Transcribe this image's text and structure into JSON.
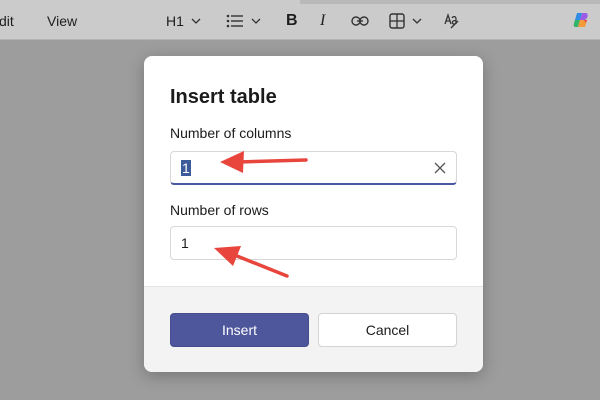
{
  "menu": {
    "edit_label": "dit",
    "view_label": "View"
  },
  "toolbar": {
    "heading_label": "H1",
    "bold_label": "B",
    "italic_label": "I"
  },
  "dialog": {
    "title": "Insert table",
    "columns": {
      "label": "Number of columns",
      "value": "1"
    },
    "rows": {
      "label": "Number of rows",
      "value": "1"
    },
    "insert_label": "Insert",
    "cancel_label": "Cancel"
  },
  "colors": {
    "primary": "#4e569c",
    "focus_underline": "#4a57a3",
    "annotation_arrow": "#e8453c"
  },
  "icons": [
    "chevron-down-icon",
    "bullet-list-icon",
    "link-icon",
    "table-grid-icon",
    "spellcheck-icon",
    "copilot-icon",
    "clear-icon"
  ]
}
